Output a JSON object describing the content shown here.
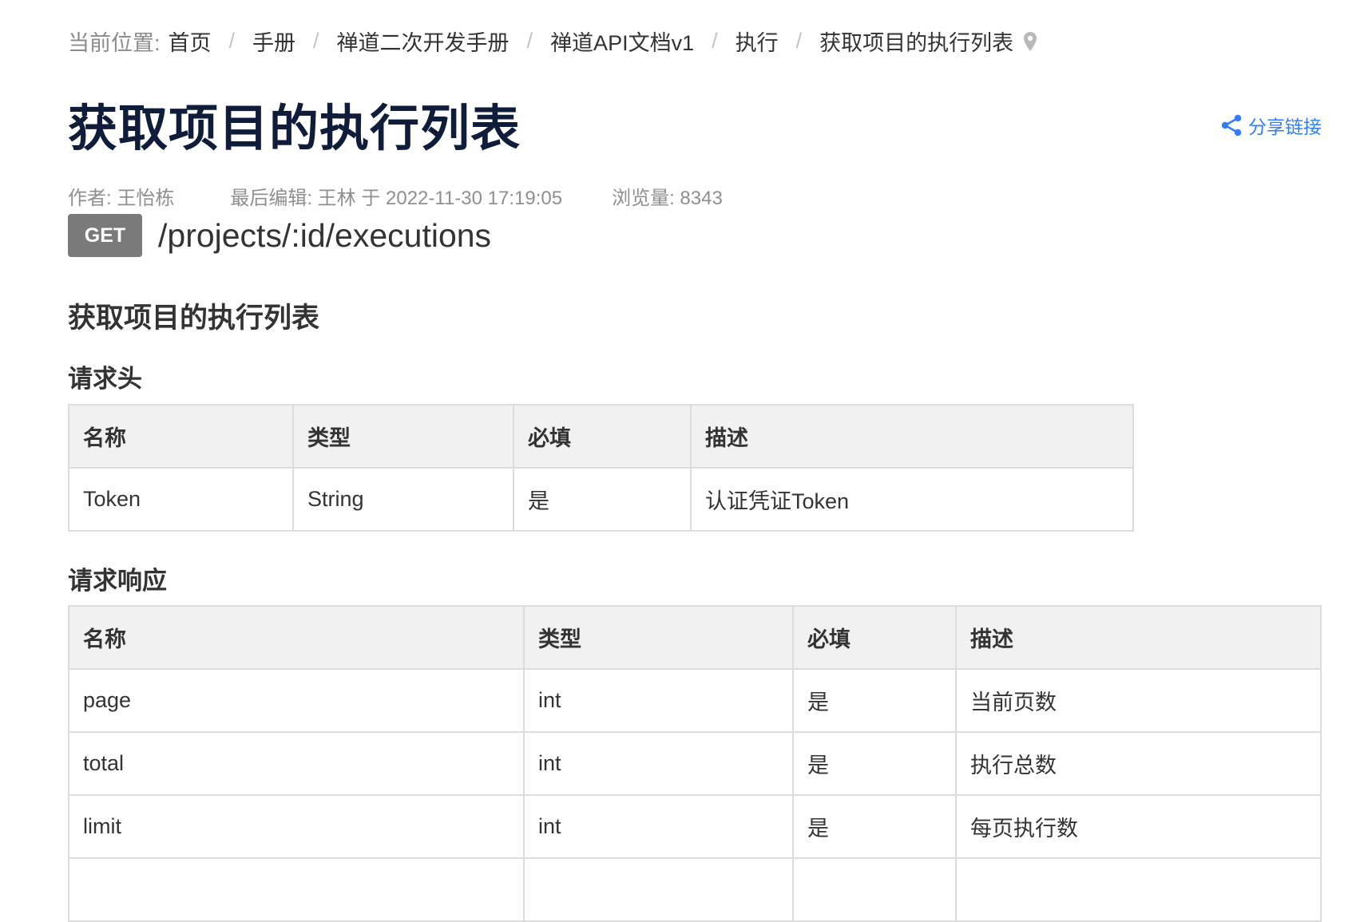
{
  "breadcrumb": {
    "prefix": "当前位置:",
    "items": [
      "首页",
      "手册",
      "禅道二次开发手册",
      "禅道API文档v1",
      "执行",
      "获取项目的执行列表"
    ]
  },
  "title": "获取项目的执行列表",
  "share_label": "分享链接",
  "meta": {
    "author": "作者: 王怡栋",
    "last_edit": "最后编辑: 王林 于 2022-11-30 17:19:05",
    "views": "浏览量: 8343"
  },
  "endpoint": {
    "method": "GET",
    "path": "/projects/:id/executions"
  },
  "description": "获取项目的执行列表",
  "request_headers": {
    "heading": "请求头",
    "columns": [
      "名称",
      "类型",
      "必填",
      "描述"
    ],
    "rows": [
      [
        "Token",
        "String",
        "是",
        "认证凭证Token"
      ]
    ]
  },
  "response": {
    "heading": "请求响应",
    "columns": [
      "名称",
      "类型",
      "必填",
      "描述"
    ],
    "rows": [
      [
        "page",
        "int",
        "是",
        "当前页数"
      ],
      [
        "total",
        "int",
        "是",
        "执行总数"
      ],
      [
        "limit",
        "int",
        "是",
        "每页执行数"
      ]
    ]
  },
  "colors": {
    "title": "#0f1d3a",
    "link": "#2f7ef8",
    "method_badge": "#7a7a7a"
  }
}
